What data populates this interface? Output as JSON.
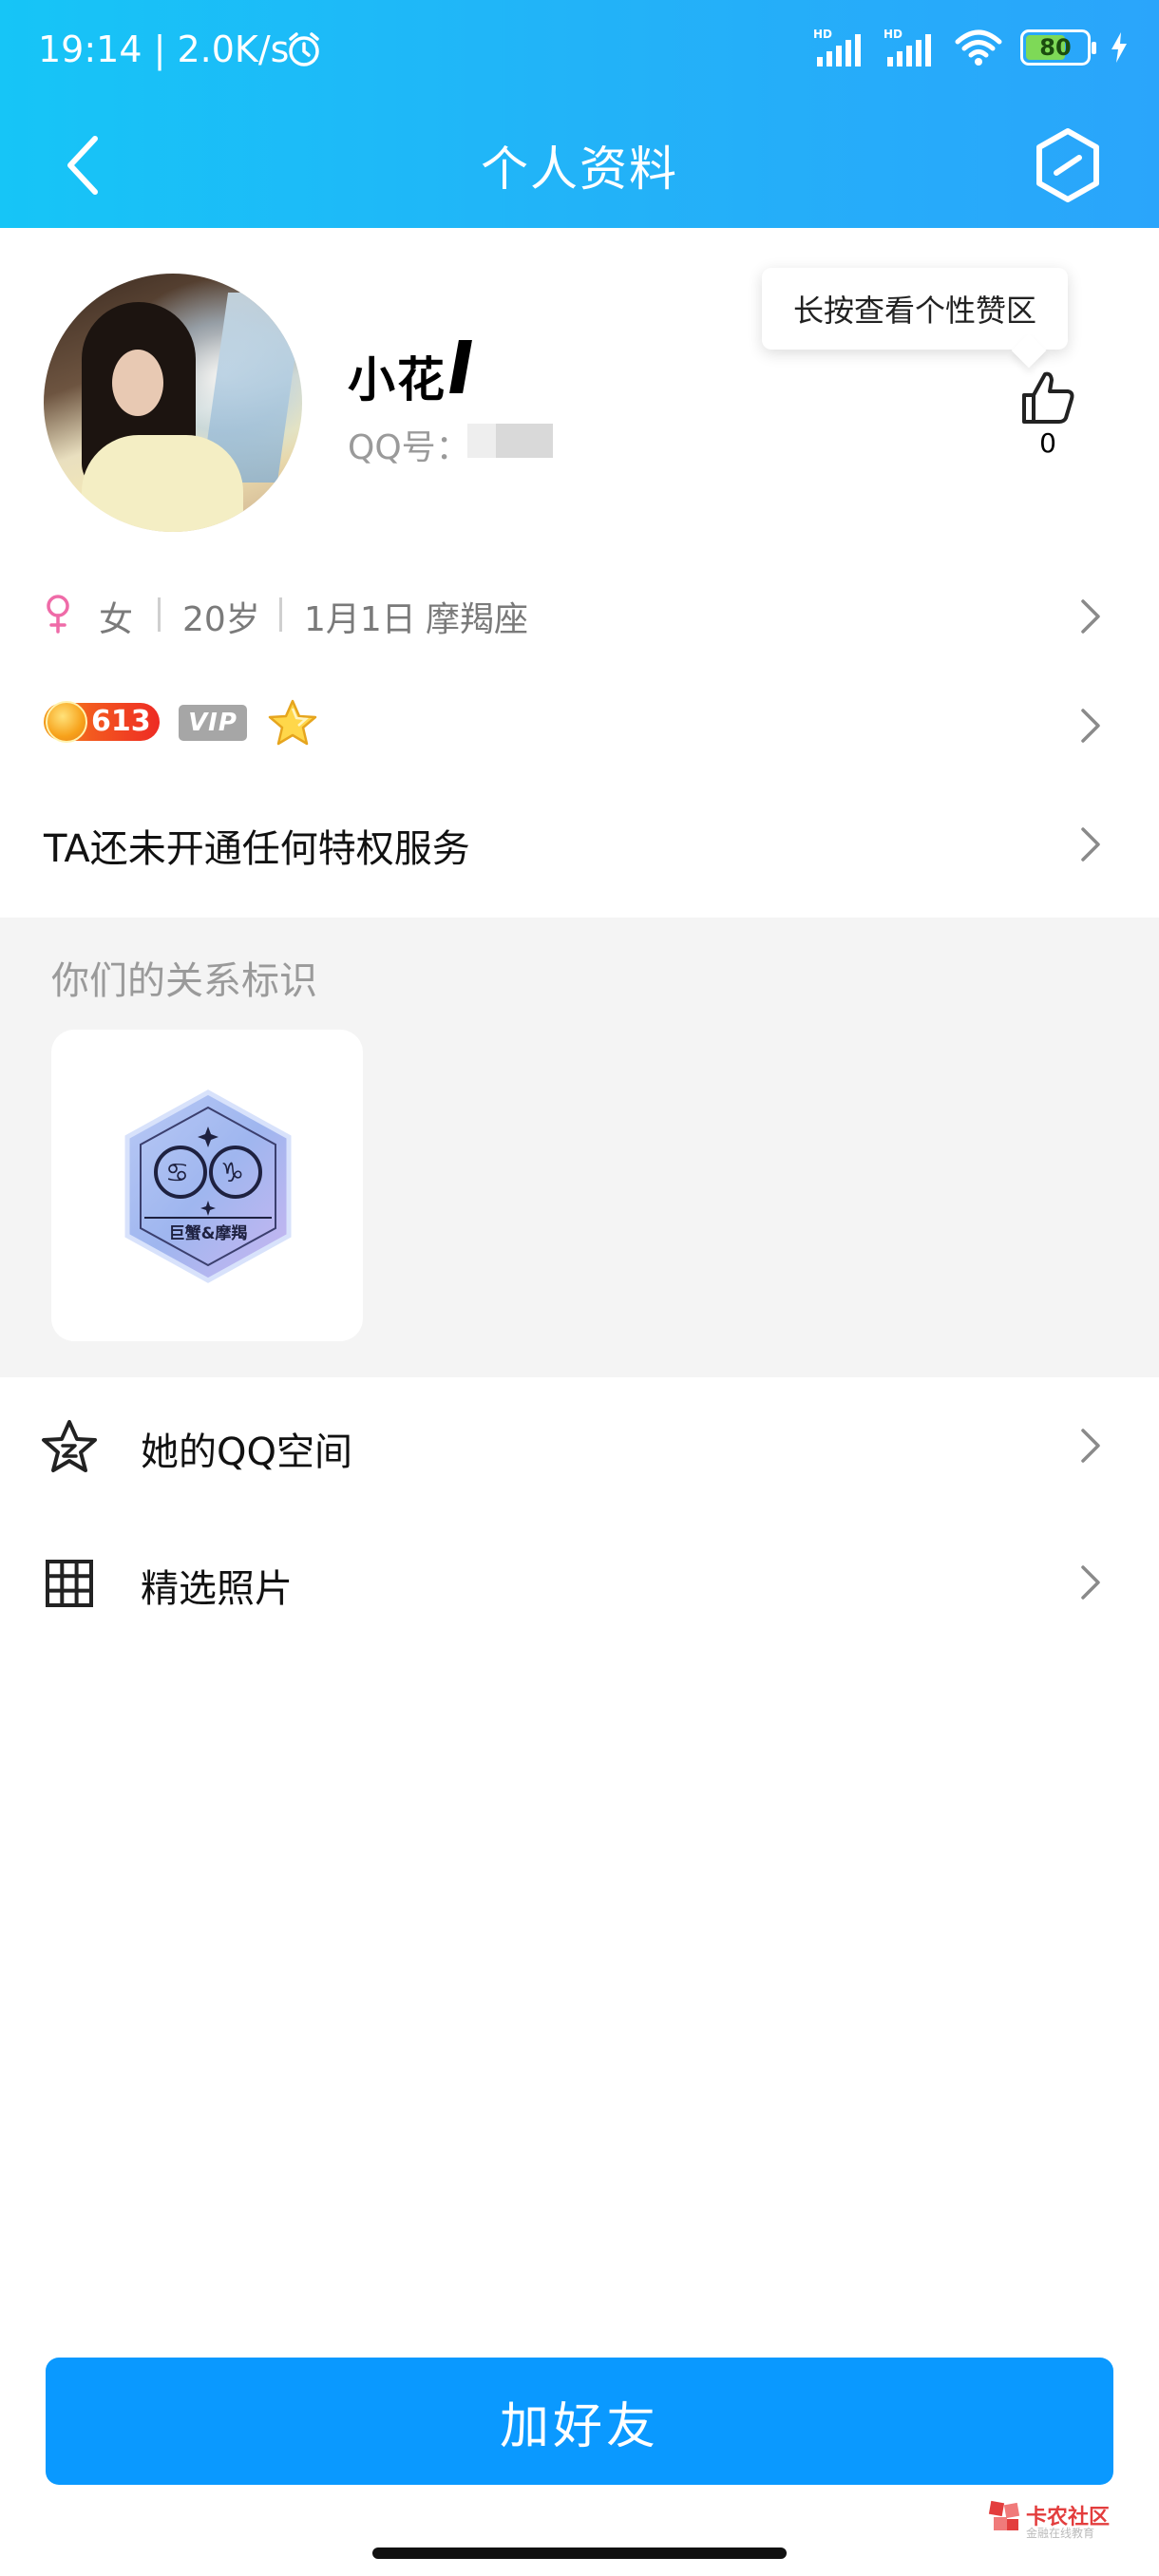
{
  "status_bar": {
    "time": "19:14",
    "speed": "2.0K/s",
    "battery": "80"
  },
  "nav": {
    "title": "个人资料"
  },
  "profile": {
    "nickname": "小花",
    "qq_label": "QQ号：",
    "tooltip": "长按查看个性赞区",
    "like_count": "0"
  },
  "info": {
    "gender": "女",
    "age": "20岁",
    "birthday": "1月1日",
    "zodiac": "摩羯座"
  },
  "badges": {
    "level": "613",
    "vip": "VIP"
  },
  "privilege": {
    "text": "TA还未开通任何特权服务"
  },
  "relation": {
    "title": "你们的关系标识",
    "badge_label": "巨蟹&摩羯"
  },
  "list": {
    "qzone": "她的QQ空间",
    "photos": "精选照片"
  },
  "action": {
    "add_friend": "加好友"
  },
  "watermark": {
    "text": "卡农社区",
    "sub": "金融在线教育"
  },
  "colors": {
    "header_start": "#16c5f7",
    "header_end": "#2aa5fb",
    "primary_button": "#0a99ff"
  },
  "icons": [
    "back-icon",
    "settings-icon",
    "like-icon",
    "female-icon",
    "chevron-right-icon",
    "star-outline-icon",
    "grid-icon",
    "alarm-icon",
    "signal-icon",
    "wifi-icon",
    "battery-icon"
  ]
}
